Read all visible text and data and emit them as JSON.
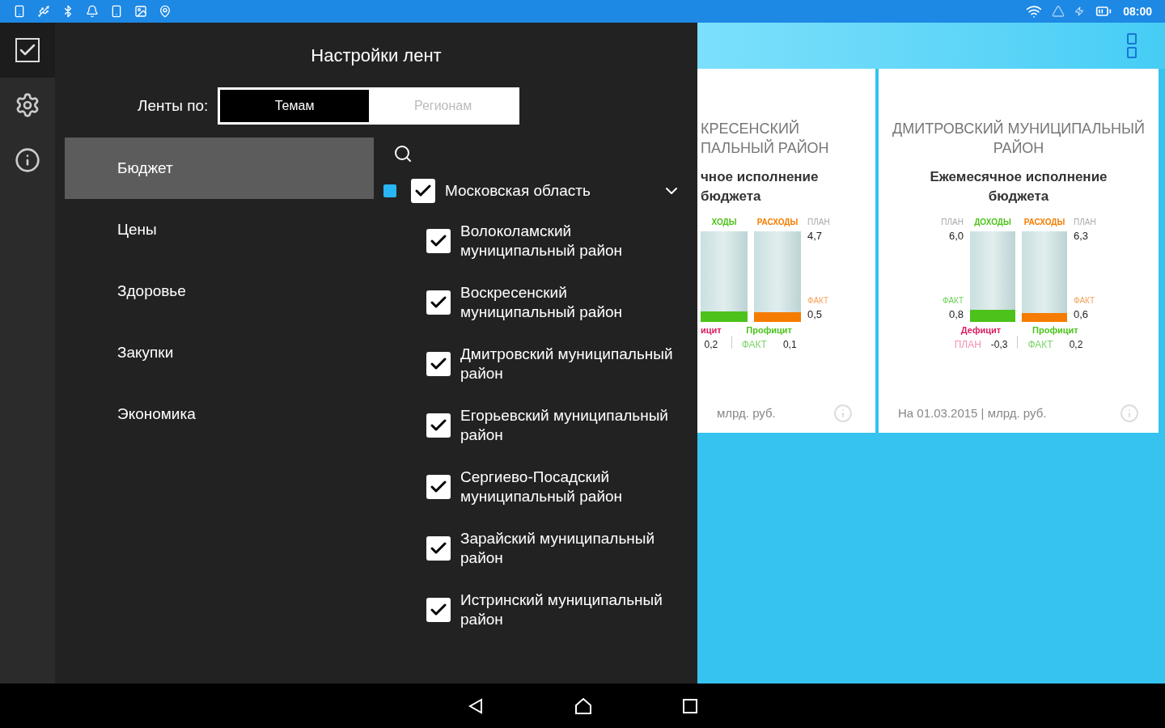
{
  "status_bar": {
    "time": "08:00"
  },
  "drawer": {
    "title": "Настройки лент",
    "filter_label": "Ленты по:",
    "segments": [
      {
        "label": "Темам",
        "selected": true
      },
      {
        "label": "Регионам",
        "selected": false
      }
    ],
    "topics": [
      {
        "label": "Бюджет",
        "selected": true
      },
      {
        "label": "Цены",
        "selected": false
      },
      {
        "label": "Здоровье",
        "selected": false
      },
      {
        "label": "Закупки",
        "selected": false
      },
      {
        "label": "Экономика",
        "selected": false
      }
    ],
    "regions": [
      {
        "label": "Московская область",
        "checked": true,
        "expanded": true,
        "color": "#29b6f6",
        "children": [
          {
            "label": "Волоколамский муниципальный район",
            "checked": true
          },
          {
            "label": "Воскресенский муниципальный район",
            "checked": true
          },
          {
            "label": "Дмитровский муниципальный район",
            "checked": true
          },
          {
            "label": "Егорьевский муниципальный район",
            "checked": true
          },
          {
            "label": "Сергиево-Посадский муниципальный район",
            "checked": true
          },
          {
            "label": "Зарайский муниципальный район",
            "checked": true
          },
          {
            "label": "Истринский муниципальный район",
            "checked": true
          }
        ]
      }
    ]
  },
  "cards": [
    {
      "title": "КРЕСЕНСКИЙ ПАЛЬНЫЙ РАЙОН",
      "subtitle": "чное исполнение бюджета",
      "bars": [
        {
          "label": "ХОДЫ",
          "color": "#4cc21b",
          "level": 0.12
        },
        {
          "label": "РАСХОДЫ",
          "color": "#f57c00",
          "level": 0.11
        }
      ],
      "right_plan_label": "ПЛАН",
      "right_plan": "4,7",
      "right_fact_label": "ФАКТ",
      "right_fact": "0,5",
      "deficit_label": "ицит",
      "plan_value": "0,2",
      "surplus_label": "Профицит",
      "fact_label": "ФАКТ",
      "fact_value": "0,1",
      "footer": "млрд. руб."
    },
    {
      "title": "ДМИТРОВСКИЙ МУНИЦИПАЛЬНЫЙ РАЙОН",
      "subtitle": "Ежемесячное исполнение бюджета",
      "left_plan_label": "ПЛАН",
      "left_plan": "6,0",
      "left_fact_label": "ФАКТ",
      "left_fact": "0,8",
      "bars": [
        {
          "label": "ДОХОДЫ",
          "color": "#4cc21b",
          "level": 0.13
        },
        {
          "label": "РАСХОДЫ",
          "color": "#f57c00",
          "level": 0.1
        }
      ],
      "right_plan_label": "ПЛАН",
      "right_plan": "6,3",
      "right_fact_label": "ФАКТ",
      "right_fact": "0,6",
      "deficit_label": "Дефицит",
      "plan_label": "ПЛАН",
      "plan_value": "-0,3",
      "surplus_label": "Профицит",
      "fact_label": "ФАКТ",
      "fact_value": "0,2",
      "footer": "На 01.03.2015 | млрд. руб."
    }
  ]
}
